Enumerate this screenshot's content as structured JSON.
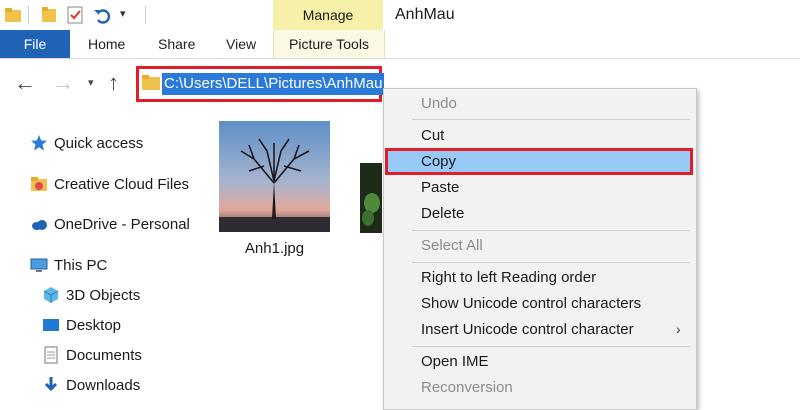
{
  "title_bar": {
    "manage_tab": "Manage",
    "window_title": "AnhMau"
  },
  "ribbon": {
    "file": "File",
    "home": "Home",
    "share": "Share",
    "view": "View",
    "picture_tools": "Picture Tools"
  },
  "address": {
    "path": "C:\\Users\\DELL\\Pictures\\AnhMau"
  },
  "sidebar": {
    "items": [
      {
        "label": "Quick access",
        "icon": "star-icon"
      },
      {
        "label": "Creative Cloud Files",
        "icon": "creative-cloud-folder-icon"
      },
      {
        "label": "OneDrive - Personal",
        "icon": "onedrive-cloud-icon"
      },
      {
        "label": "This PC",
        "icon": "computer-icon"
      },
      {
        "label": "3D Objects",
        "icon": "cube-icon"
      },
      {
        "label": "Desktop",
        "icon": "desktop-icon"
      },
      {
        "label": "Documents",
        "icon": "document-icon"
      },
      {
        "label": "Downloads",
        "icon": "download-arrow-icon"
      }
    ]
  },
  "content": {
    "files": [
      {
        "name": "Anh1.jpg"
      }
    ]
  },
  "context_menu": {
    "undo": "Undo",
    "cut": "Cut",
    "copy": "Copy",
    "paste": "Paste",
    "delete": "Delete",
    "select_all": "Select All",
    "rtl": "Right to left Reading order",
    "show_unicode": "Show Unicode control characters",
    "insert_unicode": "Insert Unicode control character",
    "open_ime": "Open IME",
    "reconversion": "Reconversion"
  },
  "colors": {
    "accent_blue": "#1f62b6",
    "selection_blue": "#2a7ad9",
    "highlight_red": "#e11d2a",
    "manage_yellow": "#f6f0a8",
    "menu_hover": "#99c9f7"
  }
}
